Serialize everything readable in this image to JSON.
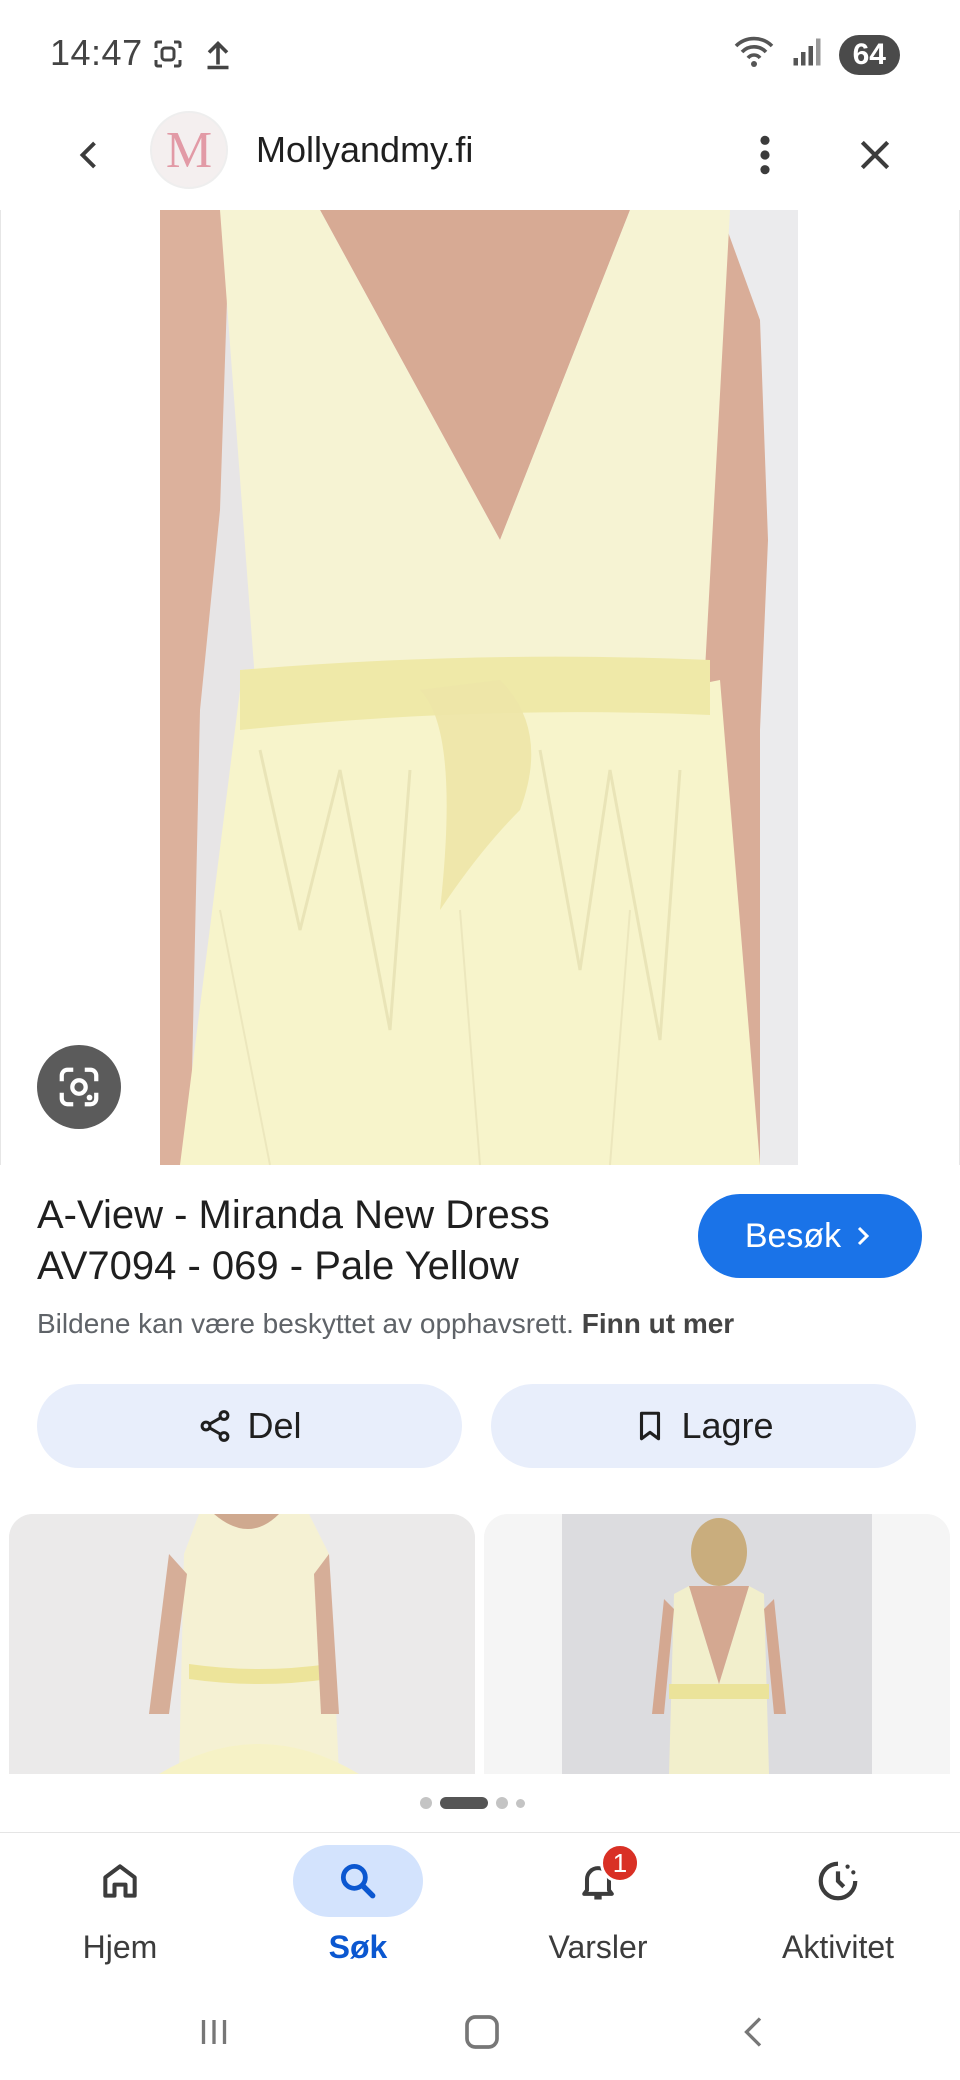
{
  "status_bar": {
    "time": "14:47",
    "battery": "64",
    "icons_left": [
      "screenshot-icon",
      "upload-icon"
    ],
    "icons_right": [
      "wifi-icon",
      "signal-icon"
    ]
  },
  "header": {
    "site_logo_letter": "M",
    "site_name": "Mollyandmy.fi"
  },
  "product": {
    "title_line1": "A-View - Miranda New Dress",
    "title_line2": "AV7094 - 069 - Pale Yellow",
    "visit_label": "Besøk",
    "copyright_text": "Bildene kan være beskyttet av opphavsrett.",
    "copyright_link": "Finn ut mer"
  },
  "actions": {
    "share_label": "Del",
    "save_label": "Lagre"
  },
  "carousel": {
    "dot_count": 4,
    "active_index": 1
  },
  "bottom_nav": {
    "items": [
      {
        "label": "Hjem",
        "icon": "home-icon"
      },
      {
        "label": "Søk",
        "icon": "search-icon",
        "active": true
      },
      {
        "label": "Varsler",
        "icon": "bell-icon",
        "badge": "1"
      },
      {
        "label": "Aktivitet",
        "icon": "activity-icon"
      }
    ]
  },
  "colors": {
    "accent": "#1a73e8",
    "dress": "#f6f3c9",
    "chip_bg": "#e8eefb",
    "active_nav": "#d3e3fd"
  }
}
